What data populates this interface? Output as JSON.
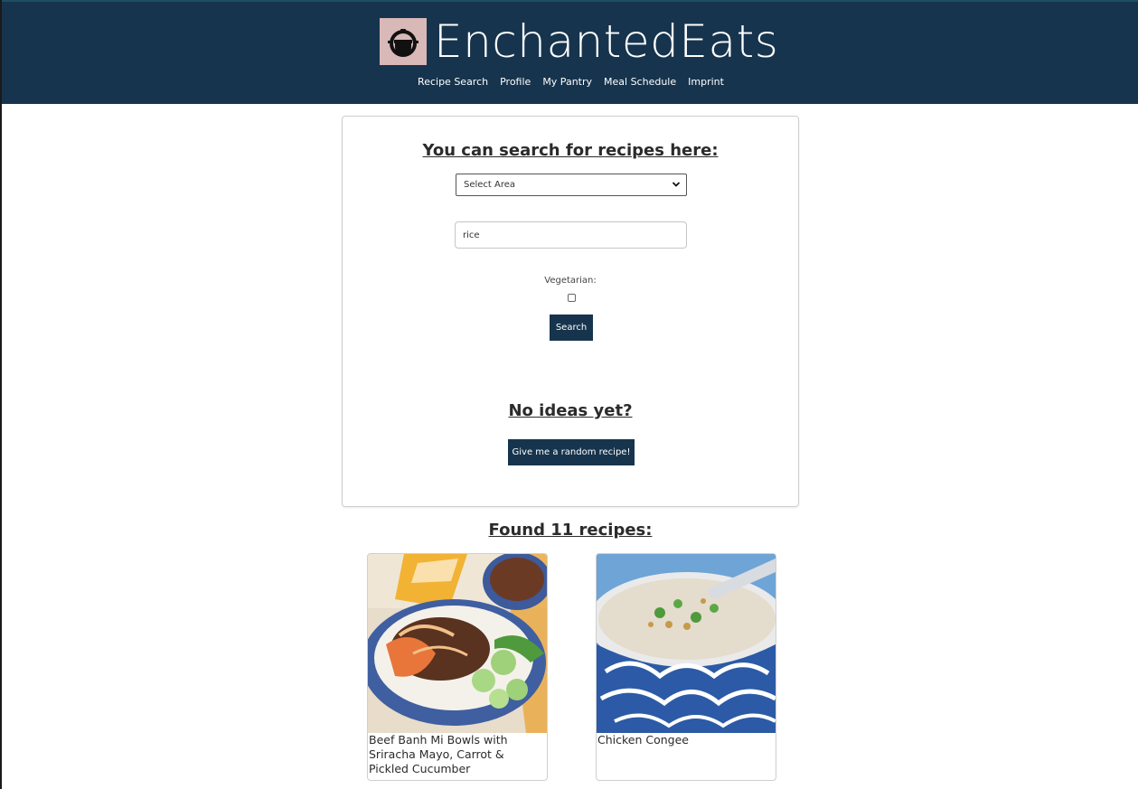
{
  "app": {
    "brand_name": "EnchantedEats",
    "logo_icon": "cooking-pot-icon",
    "colors": {
      "primary": "#16344d",
      "logo_bg": "#d9b8b8"
    }
  },
  "nav": {
    "items": [
      {
        "label": "Recipe Search"
      },
      {
        "label": "Profile"
      },
      {
        "label": "My Pantry"
      },
      {
        "label": "Meal Schedule"
      },
      {
        "label": "Imprint"
      }
    ]
  },
  "search": {
    "heading": "You can search for recipes here:",
    "area_select_value": "Select Area",
    "query_value": "rice",
    "vegetarian_label": "Vegetarian:",
    "vegetarian_checked": false,
    "search_button": "Search"
  },
  "random": {
    "heading": "No ideas yet?",
    "button_label": "Give me a random recipe!"
  },
  "results": {
    "heading": "Found 11 recipes:",
    "recipes": [
      {
        "title": "Beef Banh Mi Bowls with Sriracha Mayo, Carrot & Pickled Cucumber",
        "image": "beef-banh-mi-bowl-photo"
      },
      {
        "title": "Chicken Congee",
        "image": "chicken-congee-photo"
      }
    ]
  }
}
